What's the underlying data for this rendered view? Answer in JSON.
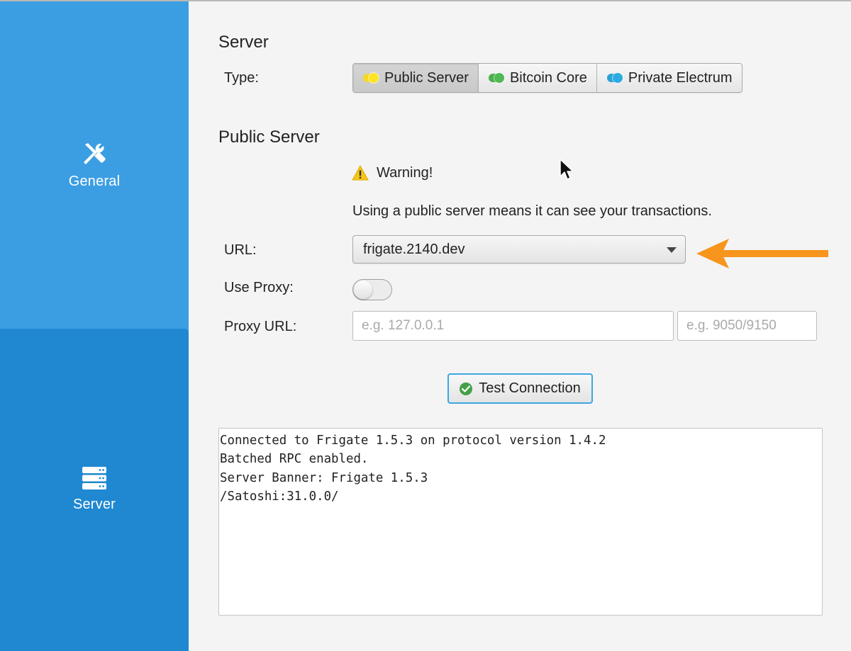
{
  "sidebar": {
    "items": [
      {
        "label": "General",
        "icon": "tools-icon",
        "selected": false
      },
      {
        "label": "Server",
        "icon": "server-icon",
        "selected": true
      }
    ]
  },
  "colors": {
    "sidebar": "#3c9ee2",
    "sidebar_selected": "#1f88d1",
    "public_toggle": "#f5d823",
    "core_toggle": "#4caf50",
    "electrum_toggle": "#29a3d6",
    "warning": "#f5c518",
    "success": "#43a047",
    "arrow": "#f7951d"
  },
  "server": {
    "title": "Server",
    "type_label": "Type:",
    "types": [
      {
        "label": "Public Server",
        "selected": true
      },
      {
        "label": "Bitcoin Core",
        "selected": false
      },
      {
        "label": "Private Electrum",
        "selected": false
      }
    ]
  },
  "public_server": {
    "title": "Public Server",
    "warning_title": "Warning!",
    "warning_text": "Using a public server means it can see your transactions.",
    "url_label": "URL:",
    "url_value": "frigate.2140.dev",
    "use_proxy_label": "Use Proxy:",
    "use_proxy_on": false,
    "proxy_url_label": "Proxy URL:",
    "proxy_host_placeholder": "e.g. 127.0.0.1",
    "proxy_port_placeholder": "e.g. 9050/9150"
  },
  "test_button": {
    "label": "Test Connection"
  },
  "output": {
    "lines": [
      "Connected to Frigate 1.5.3 on protocol version 1.4.2",
      "Batched RPC enabled.",
      "Server Banner: Frigate 1.5.3",
      "/Satoshi:31.0.0/"
    ]
  }
}
